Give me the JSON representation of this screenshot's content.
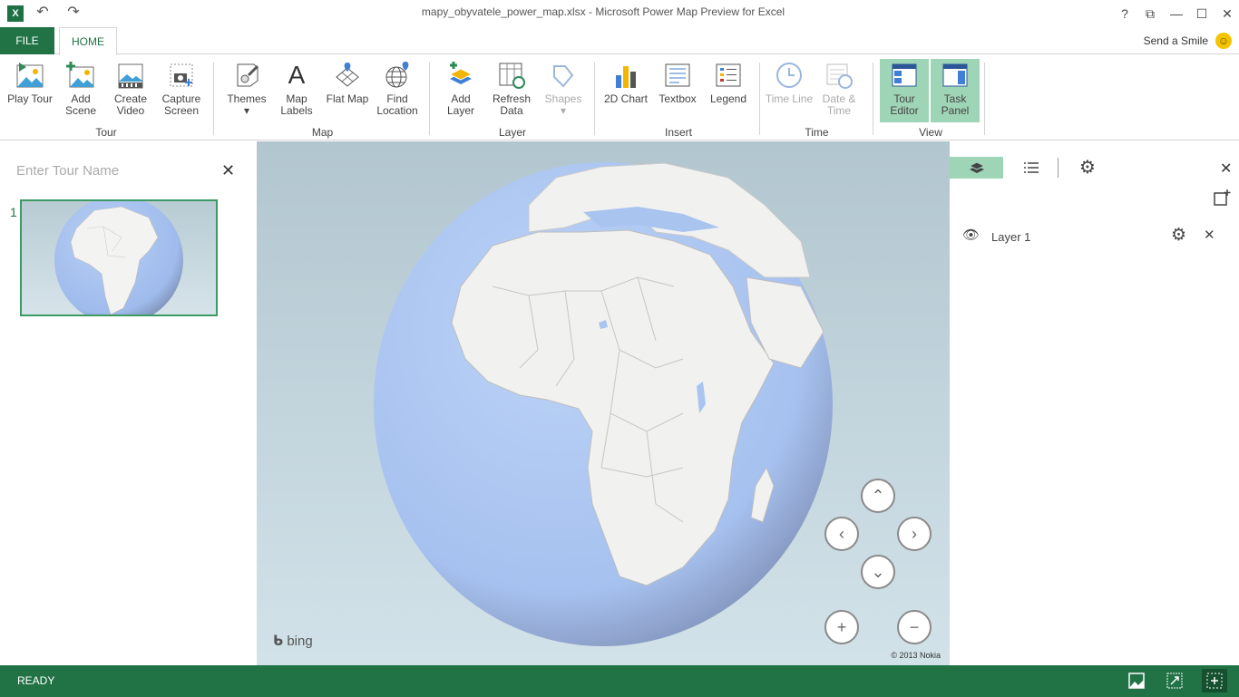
{
  "titlebar": {
    "title": "mapy_obyvatele_power_map.xlsx - Microsoft Power Map Preview for Excel",
    "app_icon": "X",
    "undo_glyph": "↶",
    "redo_glyph": "↷",
    "help_glyph": "?",
    "restore_glyph": "⧉",
    "minimize_glyph": "—",
    "maximize_glyph": "☐",
    "close_glyph": "✕"
  },
  "tabs": {
    "file": "FILE",
    "home": "HOME",
    "send_smile": "Send a Smile",
    "smile_glyph": "☺"
  },
  "ribbon": {
    "tour": {
      "label": "Tour",
      "play": "Play Tour",
      "add_scene": "Add Scene",
      "create_video": "Create Video",
      "capture": "Capture Screen"
    },
    "map": {
      "label": "Map",
      "themes": "Themes",
      "map_labels": "Map Labels",
      "flat_map": "Flat Map",
      "find_location": "Find Location",
      "map_labels_glyph": "A"
    },
    "layer": {
      "label": "Layer",
      "add_layer": "Add Layer",
      "refresh": "Refresh Data",
      "shapes": "Shapes"
    },
    "insert": {
      "label": "Insert",
      "chart": "2D Chart",
      "textbox": "Textbox",
      "legend": "Legend"
    },
    "time": {
      "label": "Time",
      "time_line": "Time Line",
      "date_time": "Date & Time"
    },
    "view": {
      "label": "View",
      "tour_editor": "Tour Editor",
      "task_panel": "Task Panel"
    }
  },
  "tour_pane": {
    "placeholder": "Enter Tour Name",
    "close_glyph": "✕",
    "scene_number": "1"
  },
  "map": {
    "bing": "bing",
    "copyright": "© 2013 Nokia",
    "nav": {
      "up": "⌃",
      "down": "⌄",
      "left": "‹",
      "right": "›",
      "zoom_in": "+",
      "zoom_out": "−"
    }
  },
  "task_panel": {
    "close_glyph": "✕",
    "layer_name": "Layer 1",
    "layer_close_glyph": "✕"
  },
  "status": {
    "text": "READY"
  },
  "colors": {
    "accent": "#217346",
    "active_button": "#9fd5b7",
    "ocean": "#a9c4ef",
    "land": "#f1f1f0"
  }
}
